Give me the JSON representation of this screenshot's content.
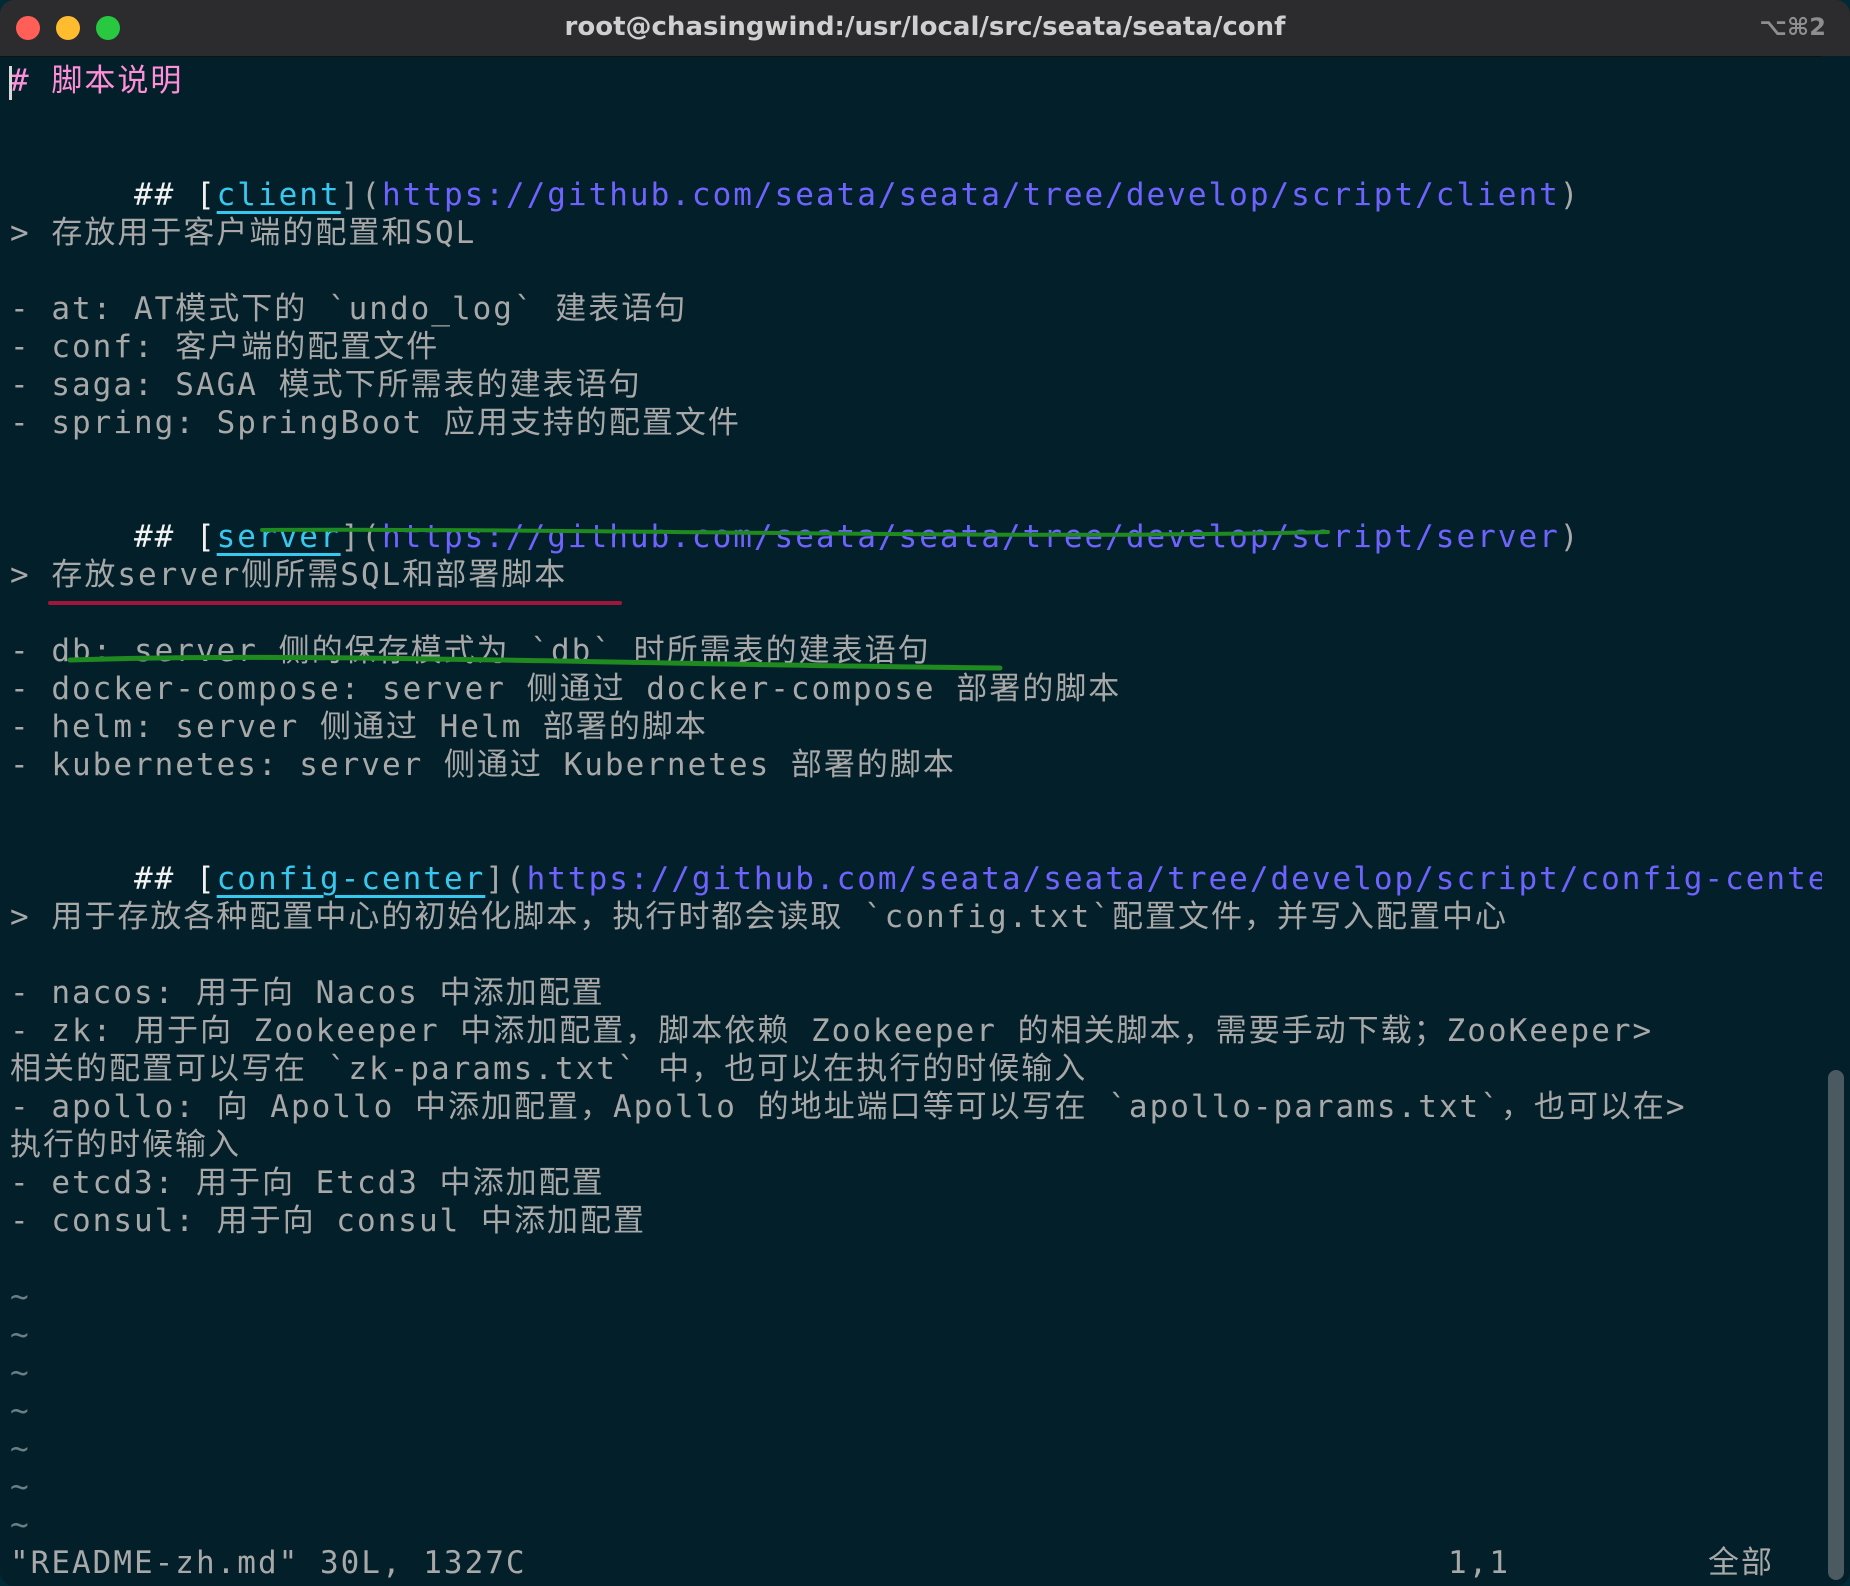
{
  "window": {
    "title": "root@chasingwind:/usr/local/src/seata/seata/conf",
    "shortcut": "⌥⌘2",
    "colors": {
      "close": "#ff5f57",
      "minimize": "#febc2e",
      "maximize": "#28c840",
      "background": "#03202a",
      "link": "#6f63ff",
      "linktext": "#37c8f0",
      "heading": "#ff8fd8"
    }
  },
  "editor": {
    "heading": "# 脚本说明",
    "client": {
      "prefix": "## [",
      "text": "client",
      "mid": "](",
      "url": "https://github.com/seata/seata/tree/develop/script/client",
      "suffix": ")"
    },
    "client_note": "> 存放用于客户端的配置和SQL",
    "client_items": [
      "- at: AT模式下的 `undo_log` 建表语句",
      "- conf: 客户端的配置文件",
      "- saga: SAGA 模式下所需表的建表语句",
      "- spring: SpringBoot 应用支持的配置文件"
    ],
    "server": {
      "prefix": "## [",
      "text": "server",
      "mid": "](",
      "url": "https://github.com/seata/seata/tree/develop/script/server",
      "suffix": ")"
    },
    "server_note": "> 存放server侧所需SQL和部署脚本",
    "server_items": [
      "- db: server 侧的保存模式为 `db` 时所需表的建表语句",
      "- docker-compose: server 侧通过 docker-compose 部署的脚本",
      "- helm: server 侧通过 Helm 部署的脚本",
      "- kubernetes: server 侧通过 Kubernetes 部署的脚本"
    ],
    "config": {
      "prefix": "## [",
      "text": "config-center",
      "mid": "](",
      "url": "https://github.com/seata/seata/tree/develop/script/config-center",
      "suffix": ")"
    },
    "config_note": "> 用于存放各种配置中心的初始化脚本，执行时都会读取 `config.txt`配置文件，并写入配置中心",
    "config_items": [
      "- nacos: 用于向 Nacos 中添加配置",
      "- zk: 用于向 Zookeeper 中添加配置，脚本依赖 Zookeeper 的相关脚本，需要手动下载；ZooKeeper>",
      "相关的配置可以写在 `zk-params.txt` 中，也可以在执行的时候输入",
      "- apollo: 向 Apollo 中添加配置，Apollo 的地址端口等可以写在 `apollo-params.txt`，也可以在>",
      "执行的时候输入",
      "- etcd3: 用于向 Etcd3 中添加配置",
      "- consul: 用于向 consul 中添加配置"
    ],
    "tilde": "~"
  },
  "status": {
    "file": "\"README-zh.md\" 30L, 1327C",
    "position": "1,1",
    "scroll": "全部"
  }
}
